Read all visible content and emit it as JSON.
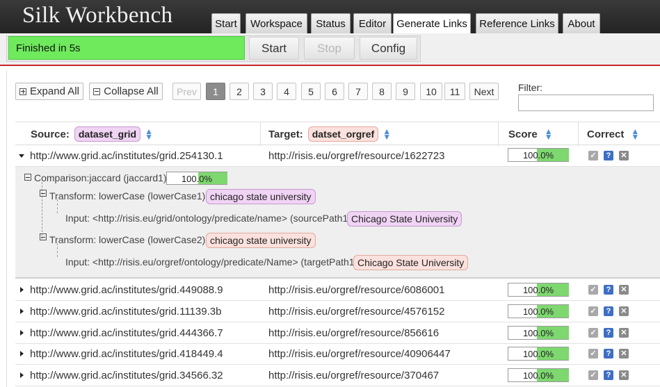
{
  "app": {
    "title": "Silk Workbench"
  },
  "nav": {
    "tabs": [
      {
        "label": "Start"
      },
      {
        "label": "Workspace"
      },
      {
        "label": "Status"
      },
      {
        "label": "Editor"
      },
      {
        "label": "Generate Links",
        "active": true
      },
      {
        "label": "Reference Links"
      },
      {
        "label": "About"
      }
    ]
  },
  "toolbar": {
    "status": "Finished in 5s",
    "status_color": "#6eea5c",
    "start_label": "Start",
    "stop_label": "Stop",
    "config_label": "Config"
  },
  "controls": {
    "expand_all": "Expand All",
    "collapse_all": "Collapse All",
    "filter_label": "Filter:",
    "filter_value": ""
  },
  "pagination": {
    "prev": "Prev",
    "next": "Next",
    "pages": [
      "1",
      "2",
      "3",
      "4",
      "5",
      "6",
      "7",
      "8",
      "9",
      "10",
      "11"
    ],
    "current": 1
  },
  "table": {
    "headers": {
      "source_label": "Source:",
      "source_dataset": "dataset_grid",
      "target_label": "Target:",
      "target_dataset": "datset_orgref",
      "score": "Score",
      "correct": "Correct"
    },
    "rows": [
      {
        "source": "http://www.grid.ac/institutes/grid.254130.1",
        "target": "http://risis.eu/orgref/resource/1622723",
        "score": "100.0%",
        "score_value": 1.0,
        "expanded": true
      },
      {
        "source": "http://www.grid.ac/institutes/grid.449088.9",
        "target": "http://risis.eu/orgref/resource/6086001",
        "score": "100.0%",
        "score_value": 1.0
      },
      {
        "source": "http://www.grid.ac/institutes/grid.11139.3b",
        "target": "http://risis.eu/orgref/resource/4576152",
        "score": "100.0%",
        "score_value": 1.0
      },
      {
        "source": "http://www.grid.ac/institutes/grid.444366.7",
        "target": "http://risis.eu/orgref/resource/856616",
        "score": "100.0%",
        "score_value": 1.0
      },
      {
        "source": "http://www.grid.ac/institutes/grid.418449.4",
        "target": "http://risis.eu/orgref/resource/40906447",
        "score": "100.0%",
        "score_value": 1.0
      },
      {
        "source": "http://www.grid.ac/institutes/grid.34566.32",
        "target": "http://risis.eu/orgref/resource/370467",
        "score": "100.0%",
        "score_value": 1.0
      }
    ]
  },
  "detail": {
    "comparison": "Comparison:jaccard (jaccard1)",
    "comparison_score": "100.0%",
    "transform1": "Transform: lowerCase (lowerCase1)",
    "transform1_value": "chicago state university",
    "input1": "Input: <http://risis.eu/grid/ontology/predicate/name> (sourcePath1)",
    "input1_value": "Chicago State University",
    "transform2": "Transform: lowerCase (lowerCase2)",
    "transform2_value": "chicago state university",
    "input2": "Input: <http://risis.eu/orgref/ontology/predicate/Name> (targetPath1)",
    "input2_value": "Chicago State University"
  },
  "icons": {
    "accept": "check-icon",
    "uncertain": "question-icon",
    "decline": "close-icon"
  }
}
